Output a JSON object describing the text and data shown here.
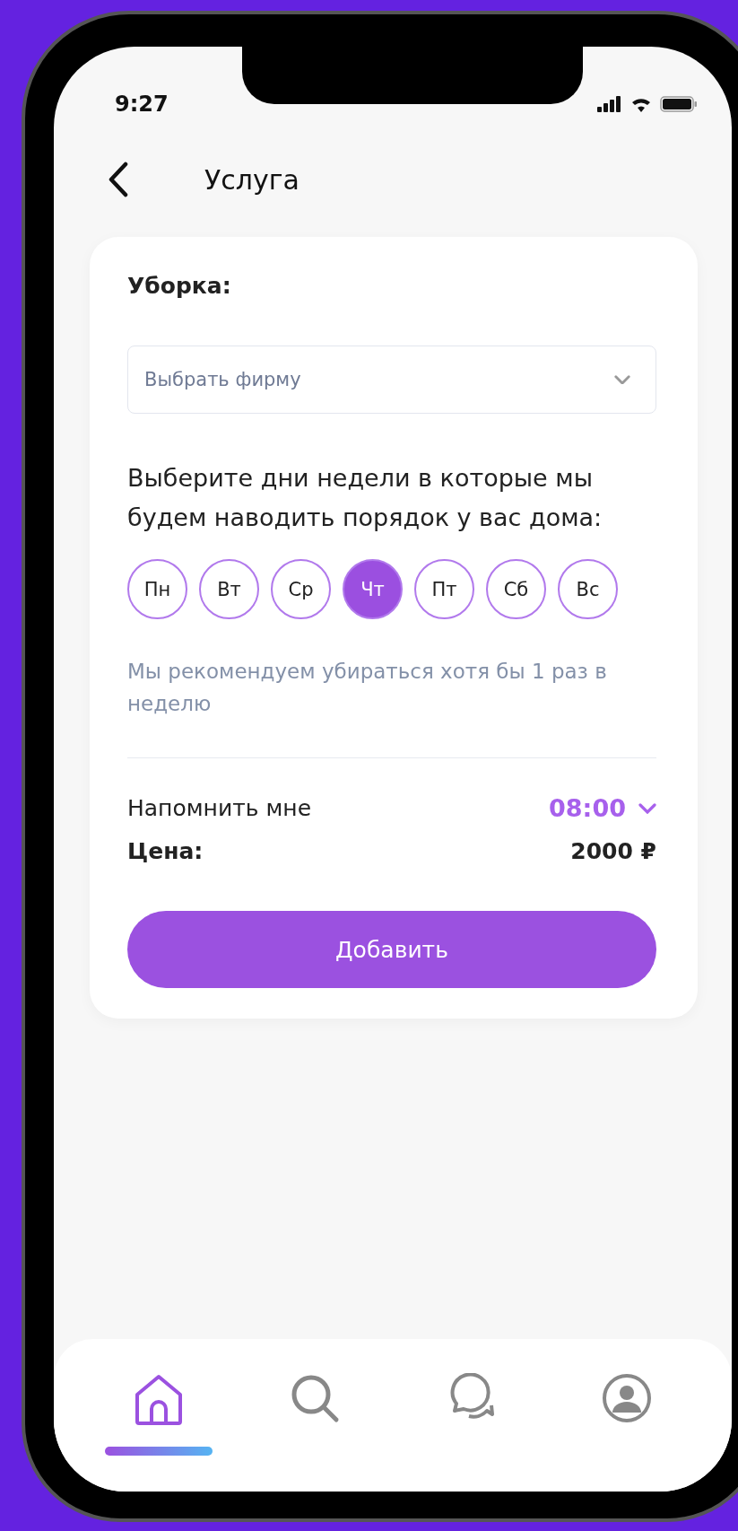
{
  "status_bar": {
    "time": "9:27"
  },
  "header": {
    "title": "Услуга"
  },
  "card": {
    "title": "Уборка:",
    "firm_select": {
      "placeholder": "Выбрать фирму"
    },
    "days_prompt": "Выберите дни недели в которые мы будем наводить порядок у вас дома:",
    "days": [
      {
        "label": "Пн",
        "selected": false
      },
      {
        "label": "Вт",
        "selected": false
      },
      {
        "label": "Ср",
        "selected": false
      },
      {
        "label": "Чт",
        "selected": true
      },
      {
        "label": "Пт",
        "selected": false
      },
      {
        "label": "Сб",
        "selected": false
      },
      {
        "label": "Вс",
        "selected": false
      }
    ],
    "hint": "Мы рекомендуем убираться хотя бы 1 раз в неделю",
    "reminder": {
      "label": "Напомнить мне",
      "time": "08:00"
    },
    "price": {
      "label": "Цена:",
      "value": "2000 ₽"
    },
    "button": "Добавить"
  },
  "bottom_nav": [
    {
      "kind": "home",
      "selected": true
    },
    {
      "kind": "search",
      "selected": false
    },
    {
      "kind": "chat",
      "selected": false
    },
    {
      "kind": "profile",
      "selected": false
    }
  ]
}
